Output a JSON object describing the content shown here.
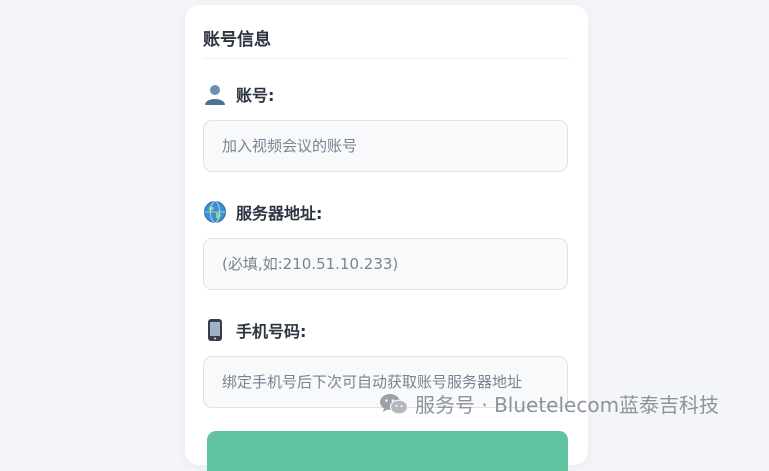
{
  "section": {
    "title": "账号信息"
  },
  "fields": [
    {
      "icon": "person-icon",
      "label": "账号:",
      "placeholder": "加入视频会议的账号",
      "value": ""
    },
    {
      "icon": "globe-icon",
      "label": "服务器地址:",
      "placeholder": "(必填,如:210.51.10.233)",
      "value": ""
    },
    {
      "icon": "mobile-phone-icon",
      "label": "手机号码:",
      "placeholder": "绑定手机号后下次可自动获取账号服务器地址",
      "value": ""
    }
  ],
  "watermark": {
    "text": "服务号 · Bluetelecom蓝泰吉科技",
    "icon": "wechat-icon"
  },
  "colors": {
    "accent_button": "#5fc3a0",
    "card": "#ffffff",
    "background": "#f3f5f9"
  }
}
